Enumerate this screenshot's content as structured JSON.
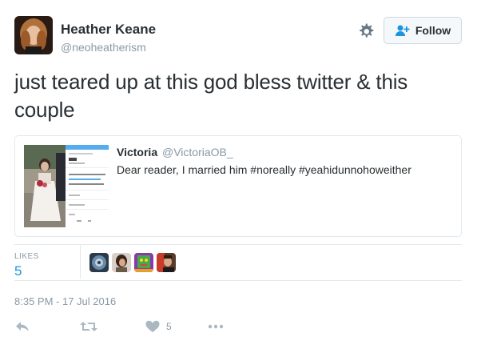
{
  "author": {
    "name": "Heather Keane",
    "handle": "@neoheatherism"
  },
  "follow_label": "Follow",
  "tweet_text": "just teared up at this god bless twitter & this couple",
  "quoted": {
    "name": "Victoria",
    "handle": "@VictoriaOB_",
    "text": "Dear reader, I married him #noreally #yeahidunnohoweither"
  },
  "likes": {
    "label": "LIKES",
    "count": "5"
  },
  "timestamp": "8:35 PM - 17 Jul 2016",
  "actions": {
    "like_count": "5"
  },
  "colors": {
    "accent": "#1b95e0",
    "muted": "#8899a6",
    "text": "#292f33",
    "border": "#e1e8ed"
  },
  "icons": [
    "gear-icon",
    "follow-person-icon",
    "reply-icon",
    "retweet-icon",
    "heart-icon",
    "more-icon"
  ]
}
